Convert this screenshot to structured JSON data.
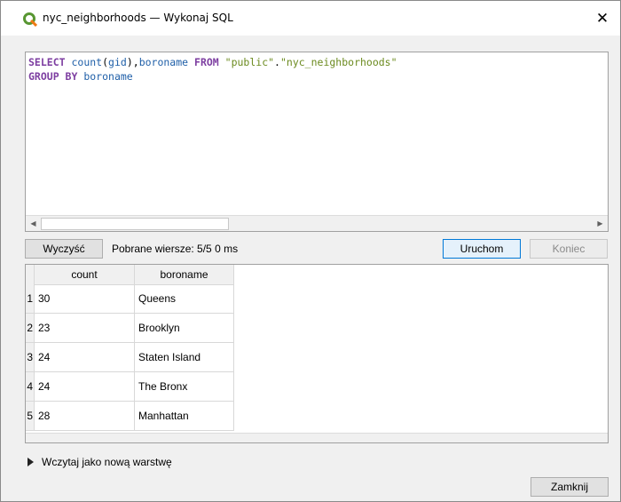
{
  "window": {
    "title": "nyc_neighborhoods — Wykonaj SQL",
    "close_glyph": "✕",
    "app_icon": "qgis-logo-icon"
  },
  "editor": {
    "tokens_line1": [
      {
        "text": "SELECT",
        "cls": "kw"
      },
      {
        "text": " ",
        "cls": "plain"
      },
      {
        "text": "count",
        "cls": "ident"
      },
      {
        "text": "(",
        "cls": "plain"
      },
      {
        "text": "gid",
        "cls": "ident"
      },
      {
        "text": "),",
        "cls": "plain"
      },
      {
        "text": "boroname",
        "cls": "ident"
      },
      {
        "text": " ",
        "cls": "plain"
      },
      {
        "text": "FROM",
        "cls": "kw"
      },
      {
        "text": " ",
        "cls": "plain"
      },
      {
        "text": "\"public\"",
        "cls": "str"
      },
      {
        "text": ".",
        "cls": "plain"
      },
      {
        "text": "\"nyc_neighborhoods\"",
        "cls": "str"
      }
    ],
    "tokens_line2": [
      {
        "text": "GROUP BY",
        "cls": "kw"
      },
      {
        "text": " ",
        "cls": "plain"
      },
      {
        "text": "boroname",
        "cls": "ident"
      }
    ]
  },
  "toolbar": {
    "clear_label": "Wyczyść",
    "status": "Pobrane wiersze: 5/5  0 ms",
    "run_label": "Uruchom",
    "stop_label": "Koniec"
  },
  "results": {
    "columns": [
      "count",
      "boroname"
    ],
    "rows": [
      {
        "num": "1",
        "count": "30",
        "boroname": "Queens"
      },
      {
        "num": "2",
        "count": "23",
        "boroname": "Brooklyn"
      },
      {
        "num": "3",
        "count": "24",
        "boroname": "Staten Island"
      },
      {
        "num": "4",
        "count": "24",
        "boroname": "The Bronx"
      },
      {
        "num": "5",
        "count": "28",
        "boroname": "Manhattan"
      }
    ]
  },
  "footer": {
    "load_layer_label": "Wczytaj jako nową warstwę",
    "close_label": "Zamknij"
  }
}
